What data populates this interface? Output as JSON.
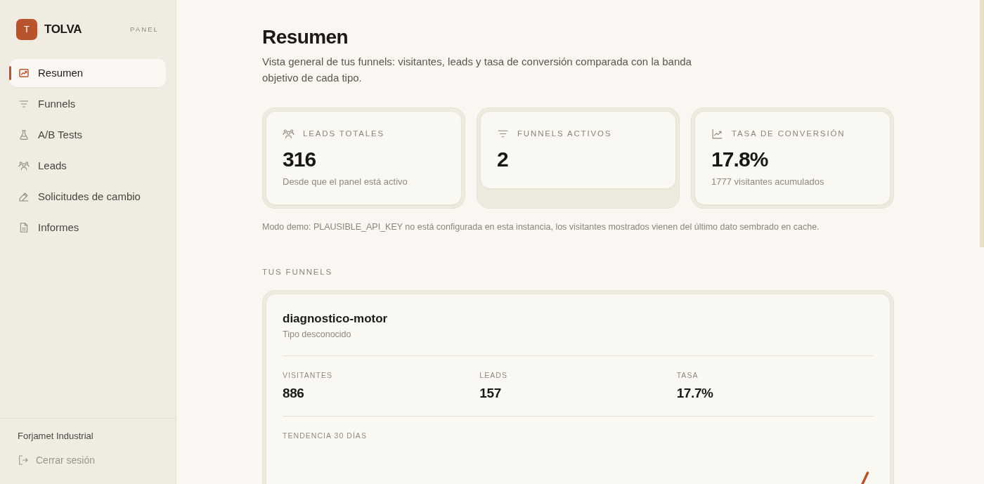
{
  "sidebar": {
    "logo_letter": "T",
    "brand": "TOLVA",
    "badge": "PANEL",
    "nav": [
      {
        "label": "Resumen",
        "selected": true
      },
      {
        "label": "Funnels",
        "selected": false
      },
      {
        "label": "A/B Tests",
        "selected": false
      },
      {
        "label": "Leads",
        "selected": false
      },
      {
        "label": "Solicitudes de cambio",
        "selected": false
      },
      {
        "label": "Informes",
        "selected": false
      }
    ],
    "organization": "Forjamet Industrial",
    "logout": "Cerrar sesión"
  },
  "header": {
    "title": "Resumen",
    "description": "Vista general de tus funnels: visitantes, leads y tasa de conversión comparada con la banda objetivo de cada tipo."
  },
  "stat_cards": [
    {
      "label": "LEADS TOTALES",
      "value": "316",
      "caption": "Desde que el panel está activo"
    },
    {
      "label": "FUNNELS ACTIVOS",
      "value": "2"
    },
    {
      "label": "TASA DE CONVERSIÓN",
      "value": "17.8%",
      "caption": "1777 visitantes acumulados"
    }
  ],
  "notice": "Modo demo: PLAUSIBLE_API_KEY no está configurada en esta instancia, los visitantes mostrados vienen del último dato sembrado en cache.",
  "funnels_section": {
    "heading": "TUS FUNNELS",
    "funnels": [
      {
        "name": "diagnostico-motor",
        "type": "Tipo desconocido",
        "metrics": [
          {
            "label": "VISITANTES",
            "value": "886"
          },
          {
            "label": "LEADS",
            "value": "157"
          },
          {
            "label": "TASA",
            "value": "17.7%"
          }
        ],
        "trend_label": "TENDENCIA 30 DÍAS"
      }
    ]
  }
}
